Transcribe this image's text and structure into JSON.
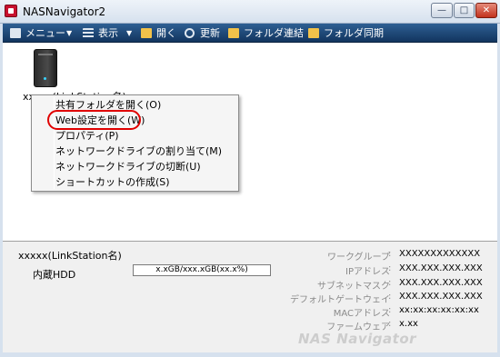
{
  "window": {
    "title": "NASNavigator2",
    "min_glyph": "—",
    "max_glyph": "□",
    "close_glyph": "✕"
  },
  "toolbar": {
    "menu_label": "メニュー",
    "view_label": "表示",
    "open_label": "開く",
    "refresh_label": "更新",
    "folder_link_label": "フォルダ連結",
    "folder_sync_label": "フォルダ同期",
    "dropdown_glyph": "▼"
  },
  "device": {
    "name": "xxxxx(LinkStation名)"
  },
  "context_menu": {
    "items": [
      "共有フォルダを開く(O)",
      "Web設定を開く(W)",
      "プロパティ(P)",
      "ネットワークドライブの割り当て(M)",
      "ネットワークドライブの切断(U)",
      "ショートカットの作成(S)"
    ]
  },
  "info": {
    "name": "xxxxx(LinkStation名)",
    "hdd_label": "内蔵HDD",
    "hdd_usage": "x.xGB/xxx.xGB(xx.x%)",
    "hdd_fill_fraction": 0.0,
    "colon": ":",
    "rows": [
      {
        "key": "ワークグループ",
        "value": "XXXXXXXXXXXXX"
      },
      {
        "key": "IPアドレス",
        "value": "XXX.XXX.XXX.XXX"
      },
      {
        "key": "サブネットマスク",
        "value": "XXX.XXX.XXX.XXX"
      },
      {
        "key": "デフォルトゲートウェイ",
        "value": "XXX.XXX.XXX.XXX"
      },
      {
        "key": "MACアドレス",
        "value": "xx:xx:xx:xx:xx:xx"
      },
      {
        "key": "ファームウェア",
        "value": "x.xx"
      }
    ],
    "watermark": "NAS Navigator"
  },
  "colors": {
    "toolbar": "#1e4676",
    "highlight": "#e00000",
    "panel": "#f0f0f0"
  }
}
